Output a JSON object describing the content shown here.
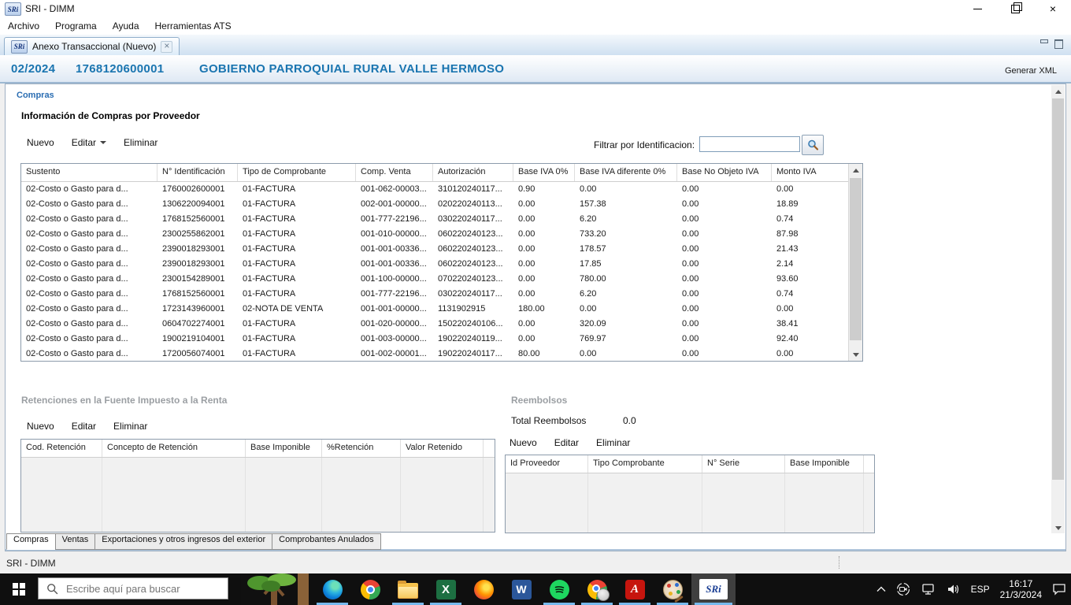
{
  "window": {
    "title": "SRI - DIMM",
    "menu": [
      "Archivo",
      "Programa",
      "Ayuda",
      "Herramientas ATS"
    ],
    "logo_text": "SRi"
  },
  "editor_tab": {
    "label": "Anexo Transaccional (Nuevo)"
  },
  "header": {
    "period": "02/2024",
    "ruc": "1768120600001",
    "taxpayer": "GOBIERNO PARROQUIAL RURAL VALLE HERMOSO",
    "generate_xml": "Generar XML"
  },
  "compras": {
    "section_label": "Compras",
    "title": "Información de Compras por Proveedor",
    "toolbar": [
      "Nuevo",
      "Editar",
      "Eliminar"
    ],
    "filter_label": "Filtrar por Identificacion:",
    "filter_value": "",
    "columns": [
      "Sustento",
      "N° Identificación",
      "Tipo de Comprobante",
      "Comp. Venta",
      "Autorización",
      "Base IVA 0%",
      "Base IVA diferente 0%",
      "Base No Objeto IVA",
      "Monto IVA"
    ],
    "rows": [
      [
        "02-Costo o Gasto para d...",
        "1760002600001",
        "01-FACTURA",
        "001-062-00003...",
        "310120240117...",
        "0.90",
        "0.00",
        "0.00",
        "0.00"
      ],
      [
        "02-Costo o Gasto para d...",
        "1306220094001",
        "01-FACTURA",
        "002-001-00000...",
        "020220240113...",
        "0.00",
        "157.38",
        "0.00",
        "18.89"
      ],
      [
        "02-Costo o Gasto para d...",
        "1768152560001",
        "01-FACTURA",
        "001-777-22196...",
        "030220240117...",
        "0.00",
        "6.20",
        "0.00",
        "0.74"
      ],
      [
        "02-Costo o Gasto para d...",
        "2300255862001",
        "01-FACTURA",
        "001-010-00000...",
        "060220240123...",
        "0.00",
        "733.20",
        "0.00",
        "87.98"
      ],
      [
        "02-Costo o Gasto para d...",
        "2390018293001",
        "01-FACTURA",
        "001-001-00336...",
        "060220240123...",
        "0.00",
        "178.57",
        "0.00",
        "21.43"
      ],
      [
        "02-Costo o Gasto para d...",
        "2390018293001",
        "01-FACTURA",
        "001-001-00336...",
        "060220240123...",
        "0.00",
        "17.85",
        "0.00",
        "2.14"
      ],
      [
        "02-Costo o Gasto para d...",
        "2300154289001",
        "01-FACTURA",
        "001-100-00000...",
        "070220240123...",
        "0.00",
        "780.00",
        "0.00",
        "93.60"
      ],
      [
        "02-Costo o Gasto para d...",
        "1768152560001",
        "01-FACTURA",
        "001-777-22196...",
        "030220240117...",
        "0.00",
        "6.20",
        "0.00",
        "0.74"
      ],
      [
        "02-Costo o Gasto para d...",
        "1723143960001",
        "02-NOTA DE VENTA",
        "001-001-00000...",
        "1131902915",
        "180.00",
        "0.00",
        "0.00",
        "0.00"
      ],
      [
        "02-Costo o Gasto para d...",
        "0604702274001",
        "01-FACTURA",
        "001-020-00000...",
        "150220240106...",
        "0.00",
        "320.09",
        "0.00",
        "38.41"
      ],
      [
        "02-Costo o Gasto para d...",
        "1900219104001",
        "01-FACTURA",
        "001-003-00000...",
        "190220240119...",
        "0.00",
        "769.97",
        "0.00",
        "92.40"
      ],
      [
        "02-Costo o Gasto para d...",
        "1720056074001",
        "01-FACTURA",
        "001-002-00001...",
        "190220240117...",
        "80.00",
        "0.00",
        "0.00",
        "0.00"
      ]
    ]
  },
  "retenciones": {
    "label": "Retenciones en la Fuente  Impuesto a la Renta",
    "toolbar": [
      "Nuevo",
      "Editar",
      "Eliminar"
    ],
    "columns": [
      "Cod. Retención",
      "Concepto de Retención",
      "Base Imponible",
      "%Retención",
      "Valor Retenido"
    ],
    "rows": []
  },
  "reembolsos": {
    "label": "Reembolsos",
    "total_label": "Total Reembolsos",
    "total_value": "0.0",
    "toolbar": [
      "Nuevo",
      "Editar",
      "Eliminar"
    ],
    "columns": [
      "Id Proveedor",
      "Tipo Comprobante",
      "N° Serie",
      "Base Imponible"
    ],
    "rows": []
  },
  "bottom_tabs": {
    "active": "Compras",
    "tabs": [
      "Compras",
      "Ventas",
      "Exportaciones y otros ingresos del exterior",
      "Comprobantes Anulados"
    ]
  },
  "status_bar": {
    "text": "SRI - DIMM"
  },
  "taskbar": {
    "search": {
      "placeholder": "Escribe aquí para buscar"
    },
    "apps": [
      {
        "name": "edge",
        "running": true
      },
      {
        "name": "chrome",
        "running": false
      },
      {
        "name": "file-explorer",
        "running": true
      },
      {
        "name": "excel",
        "running": true
      },
      {
        "name": "firefox",
        "running": false
      },
      {
        "name": "word",
        "running": false
      },
      {
        "name": "spotify",
        "running": true
      },
      {
        "name": "chrome-profile",
        "running": true
      },
      {
        "name": "acrobat",
        "running": true
      },
      {
        "name": "paint",
        "running": true
      },
      {
        "name": "sri-dimm",
        "running": true,
        "active": true
      }
    ],
    "tray": {
      "language": "ESP",
      "time": "16:17",
      "date": "21/3/2024"
    }
  }
}
